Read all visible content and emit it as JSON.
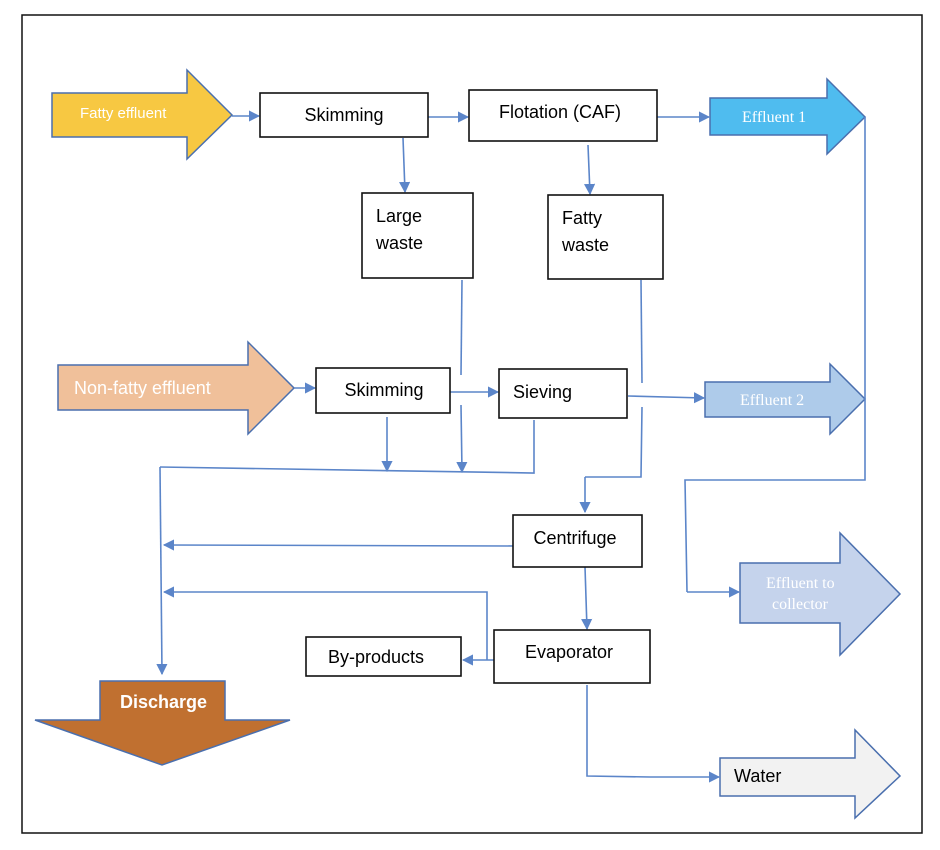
{
  "inputs": {
    "fatty_effluent": "Fatty effluent",
    "non_fatty_effluent": "Non-fatty effluent"
  },
  "processes": {
    "skimming_1": "Skimming",
    "flotation": "Flotation (CAF)",
    "large_waste_line1": "Large",
    "large_waste_line2": "waste",
    "fatty_waste_line1": "Fatty",
    "fatty_waste_line2": "waste",
    "skimming_2": "Skimming",
    "sieving": "Sieving",
    "centrifuge": "Centrifuge",
    "evaporator": "Evaporator",
    "by_products": "By-products"
  },
  "outputs": {
    "effluent_1": "Effluent 1",
    "effluent_2": "Effluent 2",
    "effluent_to_collector_line1": "Effluent to",
    "effluent_to_collector_line2": "collector",
    "discharge": "Discharge",
    "water": "Water"
  },
  "colors": {
    "fatty_effluent": "#f7c842",
    "non_fatty_effluent": "#f0c09a",
    "effluent_1": "#4fbcef",
    "effluent_2": "#aecbea",
    "effluent_to_collector": "#c5d3ec",
    "discharge": "#c07030",
    "water": "#f2f2f2",
    "connector": "#5b85c9"
  }
}
